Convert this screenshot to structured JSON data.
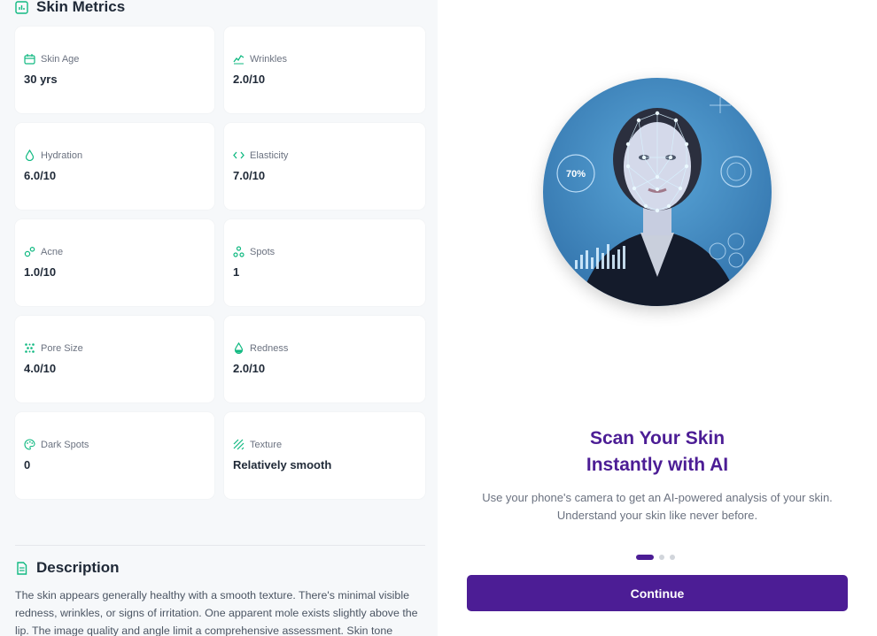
{
  "metrics": {
    "title": "Skin Metrics",
    "items": [
      {
        "icon": "calendar-icon",
        "label": "Skin Age",
        "value": "30 yrs"
      },
      {
        "icon": "wave-icon",
        "label": "Wrinkles",
        "value": "2.0/10"
      },
      {
        "icon": "droplet-icon",
        "label": "Hydration",
        "value": "6.0/10"
      },
      {
        "icon": "code-arrows-icon",
        "label": "Elasticity",
        "value": "7.0/10"
      },
      {
        "icon": "bubbles-icon",
        "label": "Acne",
        "value": "1.0/10"
      },
      {
        "icon": "spots-icon",
        "label": "Spots",
        "value": "1"
      },
      {
        "icon": "grid-dots-icon",
        "label": "Pore Size",
        "value": "4.0/10"
      },
      {
        "icon": "drop-half-icon",
        "label": "Redness",
        "value": "2.0/10"
      },
      {
        "icon": "palette-icon",
        "label": "Dark Spots",
        "value": "0"
      },
      {
        "icon": "texture-icon",
        "label": "Texture",
        "value": "Relatively smooth"
      }
    ]
  },
  "description": {
    "title": "Description",
    "text": "The skin appears generally healthy with a smooth texture. There's minimal visible redness, wrinkles, or signs of irritation. One apparent mole exists slightly above the lip. The image quality and angle limit a comprehensive assessment. Skin tone"
  },
  "onboarding": {
    "hero_badge": "70%",
    "headline_line1": "Scan Your Skin",
    "headline_line2": "Instantly with AI",
    "subtext_line1": "Use your phone's camera to get an AI-powered analysis of your skin.",
    "subtext_line2": "Understand your skin like never before.",
    "continue_label": "Continue",
    "page_count": 3,
    "active_page": 1
  },
  "colors": {
    "accent": "#4c1d95",
    "icon_green": "#10b981",
    "panel_bg": "#f6f8fa"
  }
}
